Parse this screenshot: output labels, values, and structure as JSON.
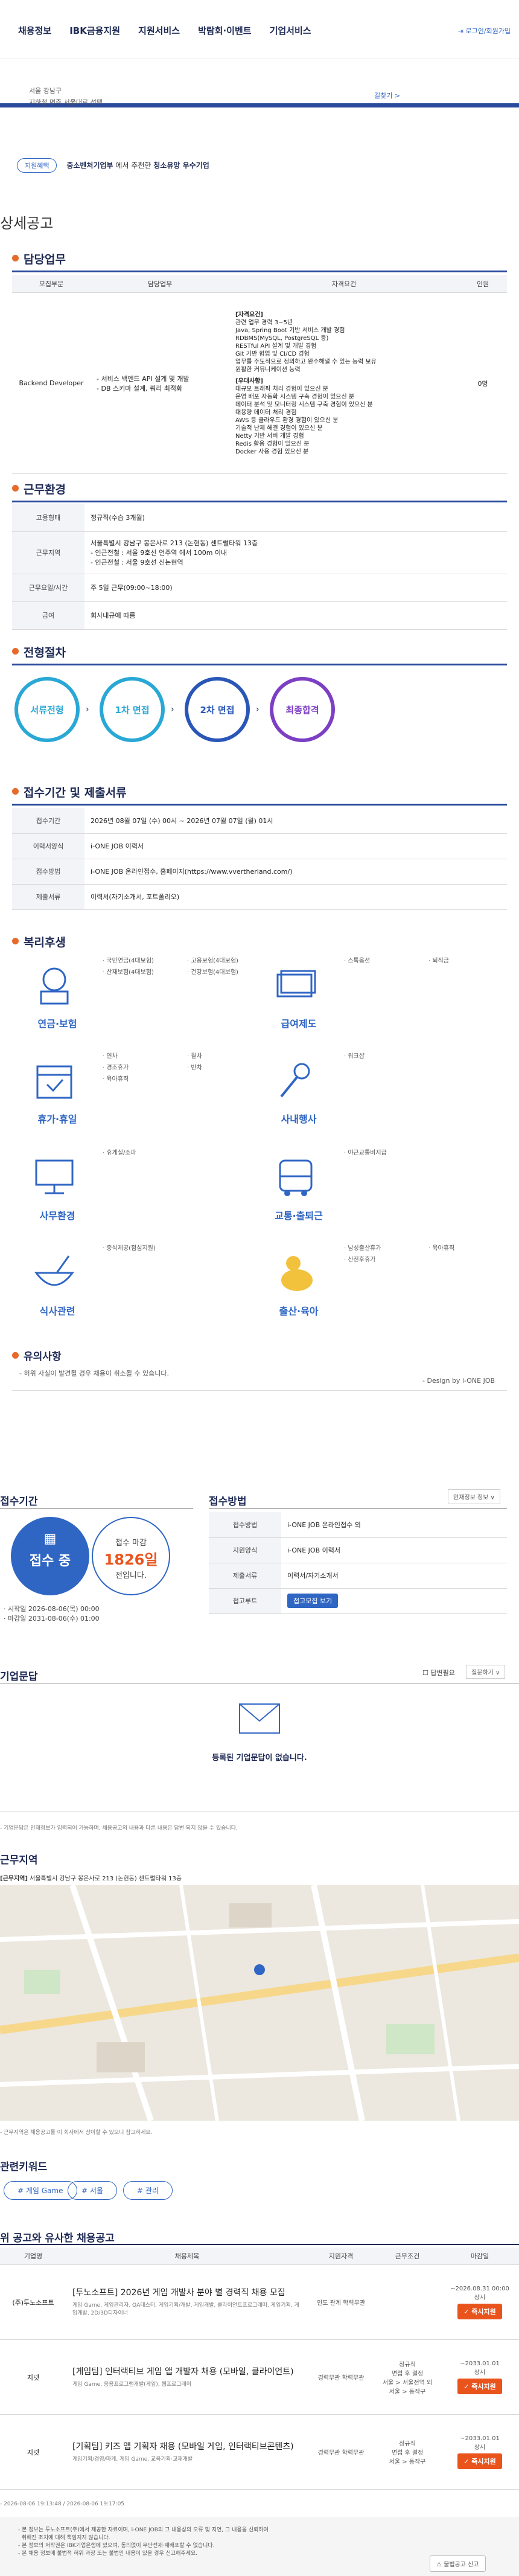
{
  "nav": {
    "menu": [
      "채용정보",
      "IBK금융지원",
      "지원서비스",
      "박람회·이벤트",
      "기업서비스"
    ],
    "login": "로그인/회원가입"
  },
  "top_info": {
    "line1": "서울 강남구",
    "line2": "지하철 면주 서울대로 선택",
    "link": "길찾기 >"
  },
  "sme": {
    "pill": "지원혜택",
    "text_bold": "중소벤처기업부",
    "text": "에서 추천한",
    "text2": "청소유망 우수기업"
  },
  "detail_title": "상세공고",
  "duties": {
    "title": "담당업무",
    "headers": [
      "모집부문",
      "담당업무",
      "자격요건",
      "인원"
    ],
    "row": {
      "part": "Backend Developer",
      "task": "- 서비스 백엔드 API 설계 및 개발\n- DB 스키마 설계, 쿼리 최적화",
      "req_head1": "[자격요건]",
      "req1": "관련 업무 경력 3~5년\nJava, Spring Boot 기반 서비스 개발 경험\nRDBMS(MySQL, PostgreSQL 등)\nRESTful API 설계 및 개발 경험\nGit 기반 협업 및 CI/CD 경험\n업무를 주도적으로 정의하고 완수해낼 수 있는 능력 보유\n원활한 커뮤니케이션 능력",
      "req_head2": "[우대사항]",
      "req2": "대규모 트래픽 처리 경험이 있으신 분\n운영 배포 자동화 시스템 구축 경험이 있으신 분\n데이터 분석 및 모니터링 시스템 구축 경험이 있으신 분\n대용량 데이터 처리 경험\nAWS 등 클라우드 환경 경험이 있으신 분\n기술적 난제 해결 경험이 있으신 분\nNetty 기반 서버 개발 경험\nRedis 활용 경험이 있으신 분\nDocker 사용 경험 있으신 분",
      "count": "0명"
    }
  },
  "environment": {
    "title": "근무환경",
    "rows": [
      {
        "label": "고용형태",
        "value": "정규직(수습 3개월)"
      },
      {
        "label": "근무지역",
        "value": "서울특별시 강남구 봉은사로 213 (논현동) 센트럴타워 13층\n- 인근전철 : 서울 9호선 언주역 에서 100m 이내\n- 인근전철 : 서울 9호선 신논현역"
      },
      {
        "label": "근무요일/시간",
        "value": "주 5일 근무(09:00~18:00)"
      },
      {
        "label": "급여",
        "value": "회사내규에 따름"
      }
    ]
  },
  "process": {
    "title": "전형절차",
    "steps": [
      "서류전형",
      "1차 면접",
      "2차 면접",
      "최종합격"
    ],
    "colors": [
      "#29a8d6",
      "#29a8d6",
      "#2a56b8",
      "#7c3fc4"
    ]
  },
  "apply_period": {
    "title": "접수기간 및 제출서류",
    "rows": [
      {
        "label": "접수기간",
        "value": "2026년 08월 07일 (수) 00시 ~ 2026년 07월 07일 (월) 01시"
      },
      {
        "label": "이력서양식",
        "value": "i-ONE JOB 이력서"
      },
      {
        "label": "접수방법",
        "value": "i-ONE JOB 온라인접수, 홈페이지(https://www.vvertherland.com/)"
      },
      {
        "label": "제출서류",
        "value": "이력서(자기소개서, 포트폴리오)"
      }
    ]
  },
  "benefits": {
    "title": "복리후생",
    "items": [
      {
        "icon": "pension-icon",
        "name": "연금·보험",
        "list": [
          "국민연금(4대보험)",
          "고용보험(4대보험)",
          "산재보험(4대보험)",
          "건강보험(4대보험)"
        ]
      },
      {
        "icon": "salary-icon",
        "name": "급여제도",
        "list": [
          "스톡옵션",
          "퇴직금"
        ]
      },
      {
        "icon": "vacation-icon",
        "name": "휴가·휴일",
        "list": [
          "연차",
          "월차",
          "경조휴가",
          "반차",
          "육아휴직"
        ]
      },
      {
        "icon": "education-icon",
        "name": "사내행사",
        "list": [
          "워크샵"
        ]
      },
      {
        "icon": "office-icon",
        "name": "사무환경",
        "list": [
          "휴게실/소파"
        ]
      },
      {
        "icon": "commute-icon",
        "name": "교통·출퇴근",
        "list": [
          "야근교통비지급"
        ]
      },
      {
        "icon": "meal-icon",
        "name": "식사관련",
        "list": [
          "중식제공(점심지원)"
        ]
      },
      {
        "icon": "childcare-icon",
        "name": "출산·육아",
        "list": [
          "남성출산휴가",
          "육아휴직",
          "산전후휴가"
        ]
      }
    ]
  },
  "notice": {
    "title": "유의사항",
    "text": "- 허위 사실이 발견될 경우 채용이 취소될 수 있습니다.",
    "design": "- Design by i-ONE JOB"
  },
  "summary": {
    "period_title": "접수기간",
    "status": "접수 중",
    "remain_label": "접수 마감",
    "remain_days": "1826일",
    "remain_suffix": "전입니다.",
    "start": "· 시작일 2026-08-06(목) 00:00",
    "end": "· 마감일 2031-08-06(수) 01:00",
    "method_title": "접수방법",
    "method_btn": "인재정보 정보 ∨",
    "method_rows": [
      {
        "label": "접수방법",
        "value": "i-ONE JOB 온라인접수 외"
      },
      {
        "label": "지원양식",
        "value": "i-ONE JOB 이력서"
      },
      {
        "label": "제출서류",
        "value": "이력서/자기소개서"
      },
      {
        "label": "접고루트",
        "value": "접고모집 보기"
      }
    ]
  },
  "qna": {
    "title": "기업문답",
    "check_label": "답변필요",
    "select_label": "질문하기 ∨",
    "empty": "등록된 기업문답이 없습니다.",
    "foot": "- 기업문답은 인재정보가 입력되어 가능하며, 채용공고의 내용과 다른 내용은 답변 되지 않을 수 있습니다."
  },
  "location": {
    "title": "근무지역",
    "address_label": "[근무지역]",
    "address": "서울특별시 강남구 봉은사로 213 (논현동) 센트럴타워 13층",
    "note": "- 근무지역은 채용공고를 이 회사에서 상이할 수 있으니 참고하세요."
  },
  "keywords": {
    "title": "관련키워드",
    "items": [
      "# 게임 Game",
      "# 서울",
      "# 관리"
    ]
  },
  "similar": {
    "title": "위 공고와 유사한 채용공고",
    "headers": [
      "기업명",
      "채용제목",
      "지원자격",
      "근무조건",
      "마감일"
    ],
    "rows": [
      {
        "company": "(주)투노소프트",
        "title": "[투노소프트] 2026년 게임 개발사 분야 별 경력직 채용 모집",
        "sub": "게임 Game, 게임관리자, QA테스터, 게임기획/개발, 게임개발, 클라이언트프로그래머, 게임기획, 게임개발, 2D/3D디자이너",
        "qual": "인도 관계 학력무관",
        "cond": "",
        "deadline": "~2026.08.31 00:00\n상시",
        "btn": "즉시지원"
      },
      {
        "company": "지넷",
        "title": "[게임팀] 인터랙티브 게임 앱 개발자 채용 (모바일, 클라이언트)",
        "sub": "게임 Game, 응용프로그램개발(게임), 웹프로그래머",
        "qual": "경력무관 학력무관",
        "cond": "정규직\n면접 후 결정\n서울 > 서울전역 외\n서울 > 동작구",
        "deadline": "~2033.01.01\n상시",
        "btn": "즉시지원"
      },
      {
        "company": "지넷",
        "title": "[기획팀] 키즈 앱 기획자 채용 (모바일 게임, 인터랙티브콘텐츠)",
        "sub": "게임기획/경영/마케, 게임 Game, 교육기획·교재개발",
        "qual": "경력무관 학력무관",
        "cond": "정규직\n면접 후 결정\n서울 > 동작구",
        "deadline": "~2033.01.01\n상시",
        "btn": "즉시지원"
      }
    ],
    "meta": "- 2026-08-06 19:13:48 / 2026-08-06 19:17:05"
  },
  "footer": {
    "lines": [
      "- 본 정보는 투노소프트(주)에서 제공한 자료이며, i-ONE JOB의 그 내용상의 오류 및 지연, 그 내용을 신뢰하여",
      "  취해진 조치에 대해 책임지지 않습니다.",
      "- 본 정보의 저작권은 IBK기업은행에 있으며, 동의없이 무단전재·재배포할 수 없습니다.",
      "- 본 채용 정보에 불법적 허위 과장 또는 불법인 내용이 있을 경우 신고해주세요."
    ],
    "report_btn": "불법공고 신고"
  }
}
